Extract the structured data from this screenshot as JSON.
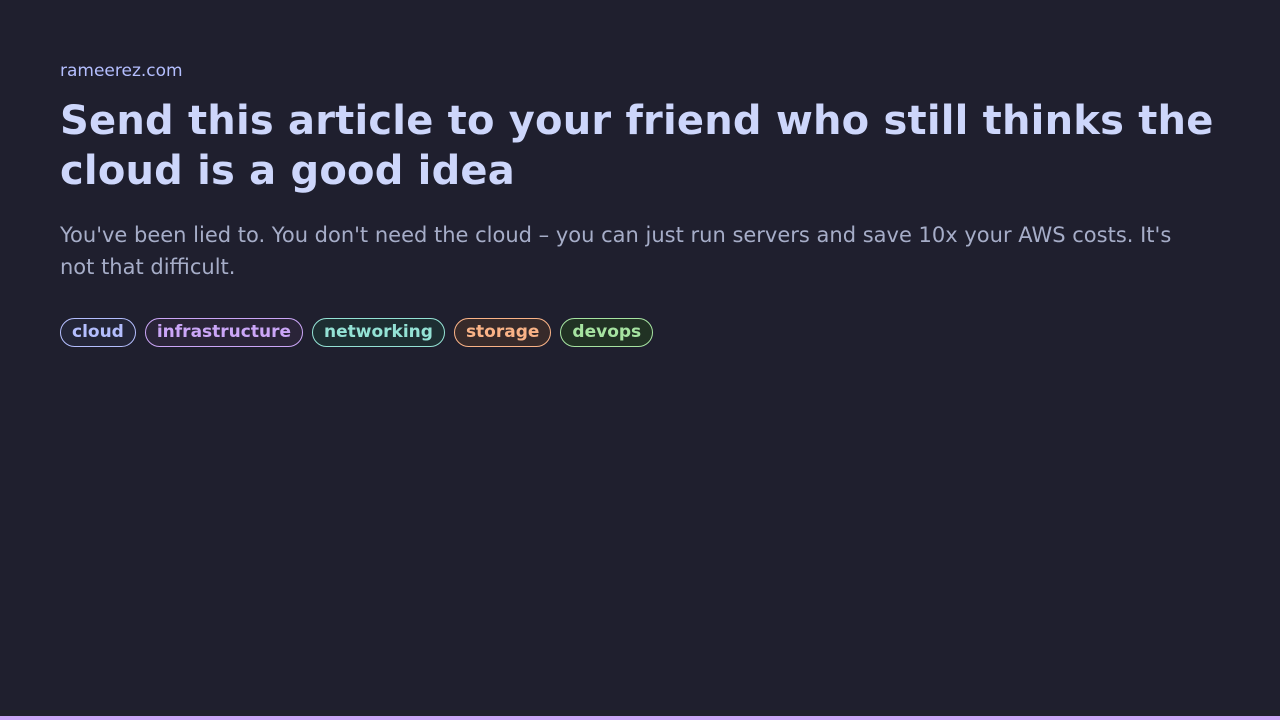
{
  "site": {
    "domain": "rameerez.com"
  },
  "article": {
    "title": "Send this article to your friend who still thinks the cloud is a good idea",
    "subtitle": "You've been lied to. You don't need the cloud – you can just run servers and save 10x your AWS costs. It's not that difficult."
  },
  "tags": [
    {
      "label": "cloud",
      "color": "#b4befe",
      "background": "#232538"
    },
    {
      "label": "infrastructure",
      "color": "#cba6f7",
      "background": "#2a2438"
    },
    {
      "label": "networking",
      "color": "#94e2d5",
      "background": "#1d2e32"
    },
    {
      "label": "storage",
      "color": "#fab387",
      "background": "#372a2a"
    },
    {
      "label": "devops",
      "color": "#a6e3a1",
      "background": "#213224"
    }
  ],
  "theme": {
    "background": "#1f1f2e",
    "accent_bar": "#cba6f7"
  }
}
